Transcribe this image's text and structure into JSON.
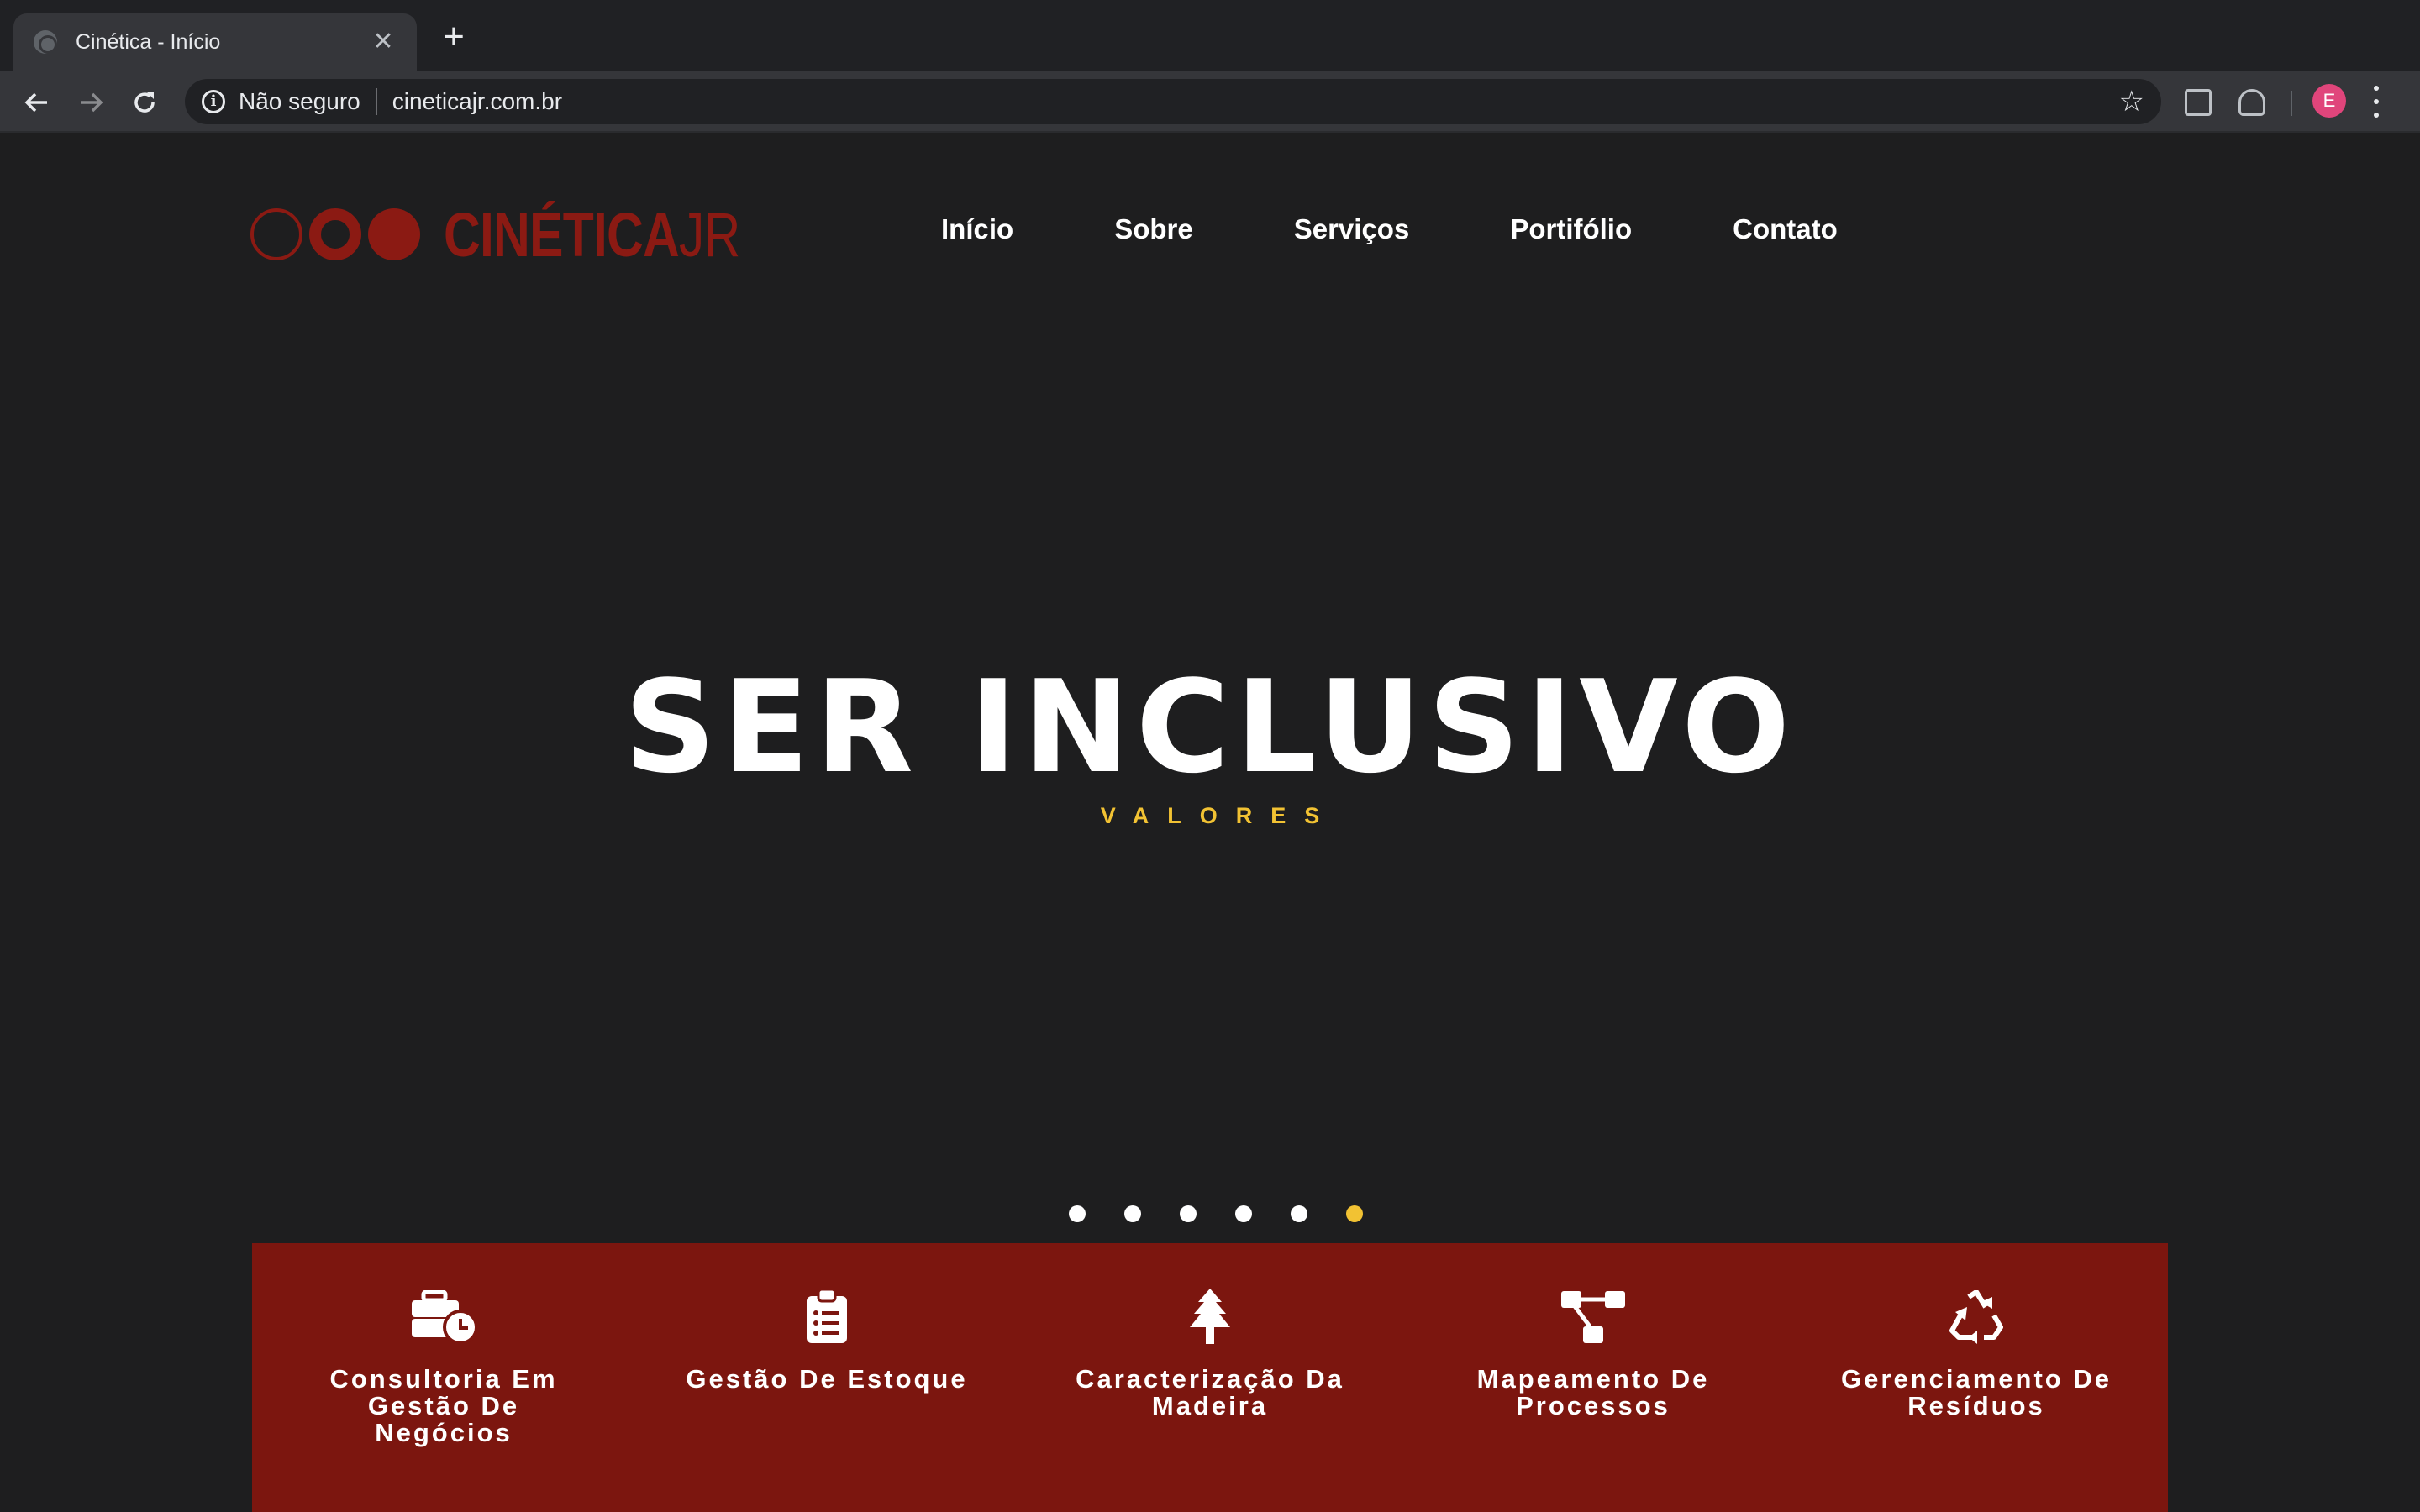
{
  "browser": {
    "tab_title": "Cinética - Início",
    "tab_close": "✕",
    "new_tab": "+",
    "security_label": "Não seguro",
    "url": "cineticajr.com.br",
    "profile_initial": "E"
  },
  "site": {
    "logo_main": "CINÉTICA",
    "logo_suffix": "JR",
    "brand_color": "#8b1a13",
    "nav": [
      "Início",
      "Sobre",
      "Serviços",
      "Portifólio",
      "Contato"
    ]
  },
  "hero": {
    "title": "SER INCLUSIVO",
    "subtitle": "VALORES",
    "slides_total": 6,
    "active_slide": 6,
    "accent_color": "#f2c233"
  },
  "services": {
    "background_color": "#7c160f",
    "items": [
      {
        "icon": "briefcase-clock-icon",
        "line1": "Consultoria Em",
        "line2": "Gestão De Negócios"
      },
      {
        "icon": "clipboard-list-icon",
        "line1": "Gestão De Estoque",
        "line2": ""
      },
      {
        "icon": "tree-icon",
        "line1": "Caracterização Da",
        "line2": "Madeira"
      },
      {
        "icon": "sitemap-icon",
        "line1": "Mapeamento De",
        "line2": "Processos"
      },
      {
        "icon": "recycle-icon",
        "line1": "Gerenciamento De",
        "line2": "Resíduos"
      }
    ]
  }
}
